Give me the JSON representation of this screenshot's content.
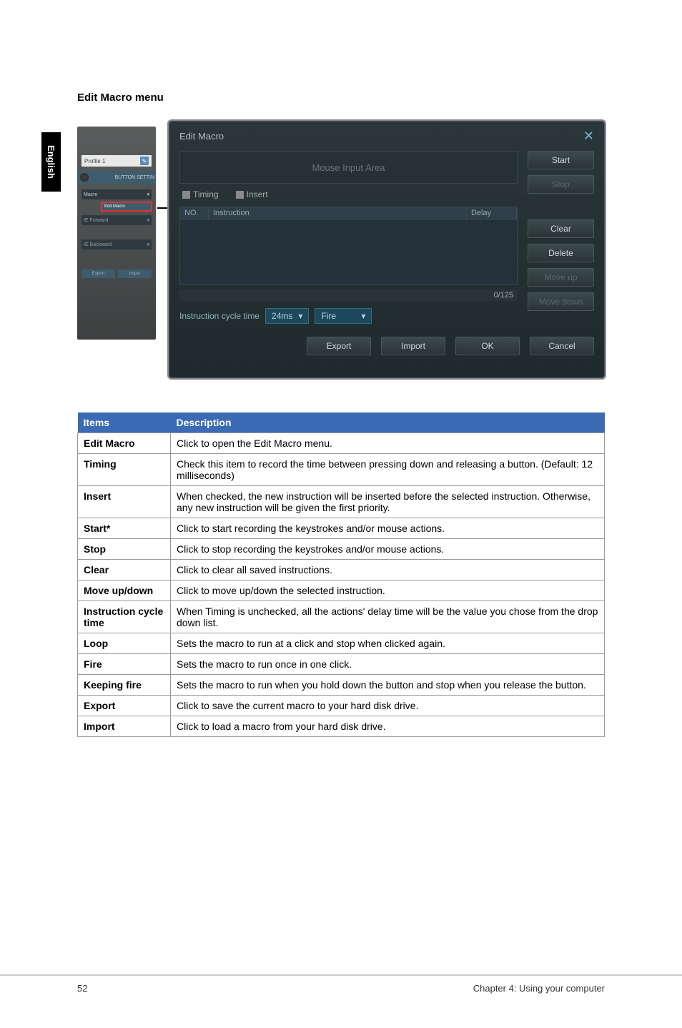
{
  "sidebar": {
    "lang": "English"
  },
  "heading": "Edit Macro menu",
  "leftPanel": {
    "profile": "Profile 1",
    "buttonSettin": "BUTTON SETTIN",
    "macro": "Macro",
    "editMacro": "Edit Macro",
    "ieForward": "IE Forward",
    "ieBackward": "IE Backward",
    "export": "Export",
    "import": "Impor"
  },
  "dialog": {
    "title": "Edit Macro",
    "mouseArea": "Mouse Input Area",
    "timing": "Timing",
    "insert": "Insert",
    "cols": {
      "no": "NO.",
      "instruction": "Instruction",
      "delay": "Delay"
    },
    "counter": "0/125",
    "cycleLabel": "Instruction cycle time",
    "cycleValue": "24ms",
    "loopValue": "Fire",
    "buttons": {
      "start": "Start",
      "stop": "Stop",
      "clear": "Clear",
      "delete": "Delete",
      "moveUp": "Move up",
      "moveDown": "Move down",
      "export": "Export",
      "import": "Import",
      "ok": "OK",
      "cancel": "Cancel"
    }
  },
  "table": {
    "headers": {
      "items": "Items",
      "desc": "Description"
    },
    "rows": [
      {
        "item": "Edit Macro",
        "desc": "Click to open the Edit Macro menu."
      },
      {
        "item": "Timing",
        "desc": "Check this item to record the time between pressing down and releasing a button. (Default: 12 milliseconds)"
      },
      {
        "item": "Insert",
        "desc": "When checked, the new instruction will be inserted before the selected instruction. Otherwise, any new instruction will be given the first priority."
      },
      {
        "item": "Start*",
        "desc": "Click to start recording the keystrokes and/or mouse actions."
      },
      {
        "item": "Stop",
        "desc": "Click to stop recording the keystrokes and/or mouse actions."
      },
      {
        "item": "Clear",
        "desc": "Click to clear all saved instructions."
      },
      {
        "item": "Move up/down",
        "desc": "Click to move up/down the selected instruction."
      },
      {
        "item": "Instruction cycle time",
        "desc": "When Timing is unchecked, all the actions' delay time will be the value you chose from the drop down list."
      },
      {
        "item": "Loop",
        "desc": "Sets the macro to run at a click and stop when clicked again."
      },
      {
        "item": "Fire",
        "desc": "Sets the macro to run once in one click."
      },
      {
        "item": "Keeping fire",
        "desc": "Sets the macro to run when you hold down the button and stop when you release the button."
      },
      {
        "item": "Export",
        "desc": "Click to save the current macro to your hard disk drive."
      },
      {
        "item": "Import",
        "desc": "Click to load a macro from your hard disk drive."
      }
    ]
  },
  "footer": {
    "page": "52",
    "chapter": "Chapter 4: Using your computer"
  }
}
